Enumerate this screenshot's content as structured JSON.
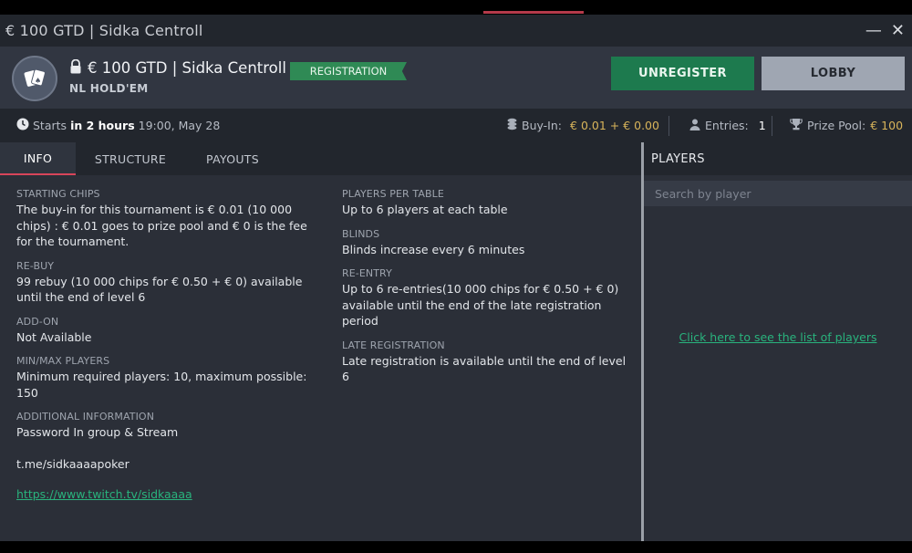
{
  "window": {
    "title": "€ 100 GTD | Sidka Centroll"
  },
  "header": {
    "name": "€ 100 GTD | Sidka Centroll",
    "badge": "REGISTRATION",
    "game": "NL HOLD'EM",
    "unregister_label": "UNREGISTER",
    "lobby_label": "LOBBY"
  },
  "infobar": {
    "starts_prefix": "Starts",
    "starts_in": "in 2 hours",
    "starts_time": "19:00, May 28",
    "buyin_label": "Buy-In:",
    "buyin_value": "€ 0.01 + € 0.00",
    "entries_label": "Entries:",
    "entries_value": "1",
    "prize_label": "Prize Pool:",
    "prize_value": "€ 100"
  },
  "tabs": [
    "INFO",
    "STRUCTURE",
    "PAYOUTS"
  ],
  "info": {
    "left": [
      {
        "label": "STARTING CHIPS",
        "value": "The buy-in for this tournament is € 0.01 (10 000 chips) : € 0.01 goes to prize pool and € 0 is the fee for the tournament."
      },
      {
        "label": "RE-BUY",
        "value": "99 rebuy (10 000 chips for € 0.50 + € 0) available until the end of level 6"
      },
      {
        "label": "ADD-ON",
        "value": "Not Available"
      },
      {
        "label": "MIN/MAX PLAYERS",
        "value": "Minimum required players: 10, maximum possible: 150"
      },
      {
        "label": "ADDITIONAL INFORMATION",
        "value": "Password In group & Stream"
      }
    ],
    "extra_text": "t.me/sidkaaaapoker",
    "extra_link": "https://www.twitch.tv/sidkaaaa",
    "right": [
      {
        "label": "PLAYERS PER TABLE",
        "value": "Up to 6 players at each table"
      },
      {
        "label": "BLINDS",
        "value": "Blinds increase every 6 minutes"
      },
      {
        "label": "RE-ENTRY",
        "value": "Up to 6 re-entries(10 000 chips for € 0.50 + € 0) available until the end of the late registration period"
      },
      {
        "label": "LATE REGISTRATION",
        "value": "Late registration is available until the end of level 6"
      }
    ]
  },
  "players": {
    "title": "PLAYERS",
    "search_placeholder": "Search by player",
    "link": "Click here to see the list of players"
  },
  "colors": {
    "accent_green": "#1d7a4e",
    "badge_green": "#2f8a55",
    "link_green": "#29b37d",
    "tab_underline": "#d8455a",
    "gold": "#d8b45a"
  },
  "icons": [
    "cards-icon",
    "lock-icon",
    "clock-icon",
    "coins-icon",
    "user-icon",
    "trophy-icon",
    "minimize-icon",
    "close-icon"
  ]
}
